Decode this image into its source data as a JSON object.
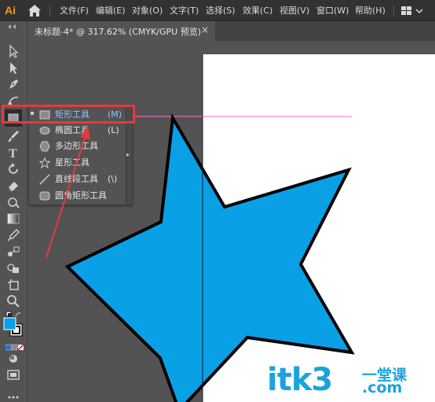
{
  "app": {
    "logo": "Ai"
  },
  "menu": [
    "文件(F)",
    "编辑(E)",
    "对象(O)",
    "文字(T)",
    "选择(S)",
    "效果(C)",
    "视图(V)",
    "窗口(W)",
    "帮助(H)"
  ],
  "document_tab": {
    "title": "未标题-4* @ 317.62% (CMYK/GPU 预览)",
    "close": "×"
  },
  "flyout": {
    "items": [
      {
        "label": "矩形工具",
        "shortcut": "(M)",
        "icon": "rectangle-icon",
        "selected": true
      },
      {
        "label": "椭圆工具",
        "shortcut": "(L)",
        "icon": "ellipse-icon",
        "selected": false
      },
      {
        "label": "多边形工具",
        "shortcut": "",
        "icon": "polygon-icon",
        "selected": false
      },
      {
        "label": "星形工具",
        "shortcut": "",
        "icon": "star-icon",
        "selected": false
      },
      {
        "label": "直线段工具",
        "shortcut": "(\\)",
        "icon": "line-segment-icon",
        "selected": false
      },
      {
        "label": "圆角矩形工具",
        "shortcut": "",
        "icon": "rounded-rectangle-icon",
        "selected": false
      }
    ]
  },
  "colors": {
    "star_fill": "#0aa0e6",
    "highlight": "#e33b3b",
    "guide": "#ff66cc",
    "fill_swatch": "#0aa0e6"
  },
  "watermark": {
    "main": "itk3",
    "cn": "一堂课",
    "com": ".com"
  }
}
